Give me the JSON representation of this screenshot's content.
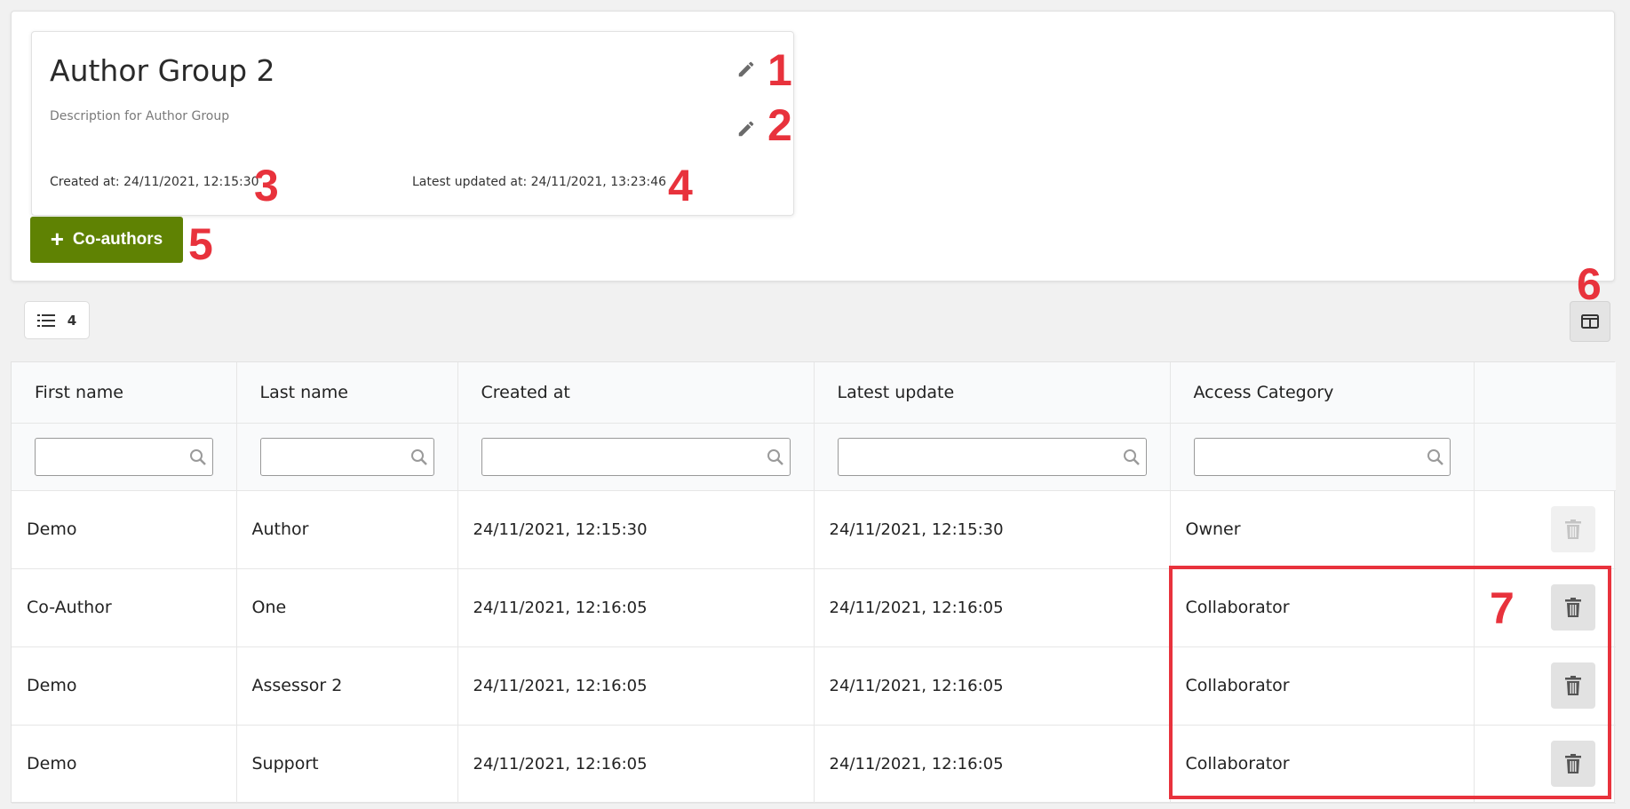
{
  "group": {
    "title": "Author Group 2",
    "description": "Description for Author Group",
    "created_at": "Created at: 24/11/2021, 12:15:30",
    "updated_at": "Latest updated at: 24/11/2021, 13:23:46",
    "edit_icon": "pencil-icon"
  },
  "actions": {
    "add_coauthors_label": "Co-authors",
    "add_icon": "plus-icon"
  },
  "toolbar": {
    "record_count": "4",
    "list_icon": "list-icon",
    "columns_icon": "columns-icon"
  },
  "table": {
    "columns": [
      "First name",
      "Last name",
      "Created at",
      "Latest update",
      "Access Category"
    ],
    "rows": [
      {
        "first_name": "Demo",
        "last_name": "Author",
        "created": "24/11/2021, 12:15:30",
        "updated": "24/11/2021, 12:15:30",
        "access": "Owner",
        "delete_enabled": false
      },
      {
        "first_name": "Co-Author",
        "last_name": "One",
        "created": "24/11/2021, 12:16:05",
        "updated": "24/11/2021, 12:16:05",
        "access": "Collaborator",
        "delete_enabled": true
      },
      {
        "first_name": "Demo",
        "last_name": "Assessor 2",
        "created": "24/11/2021, 12:16:05",
        "updated": "24/11/2021, 12:16:05",
        "access": "Collaborator",
        "delete_enabled": true
      },
      {
        "first_name": "Demo",
        "last_name": "Support",
        "created": "24/11/2021, 12:16:05",
        "updated": "24/11/2021, 12:16:05",
        "access": "Collaborator",
        "delete_enabled": true
      }
    ],
    "delete_icon": "trash-icon",
    "search_icon": "search-icon"
  },
  "annotations": {
    "c1": "1",
    "c2": "2",
    "c3": "3",
    "c4": "4",
    "c5": "5",
    "c6": "6",
    "c7": "7",
    "color": "#e8323c"
  },
  "colors": {
    "primary_button": "#5f8203",
    "annotation": "#e8323c"
  }
}
